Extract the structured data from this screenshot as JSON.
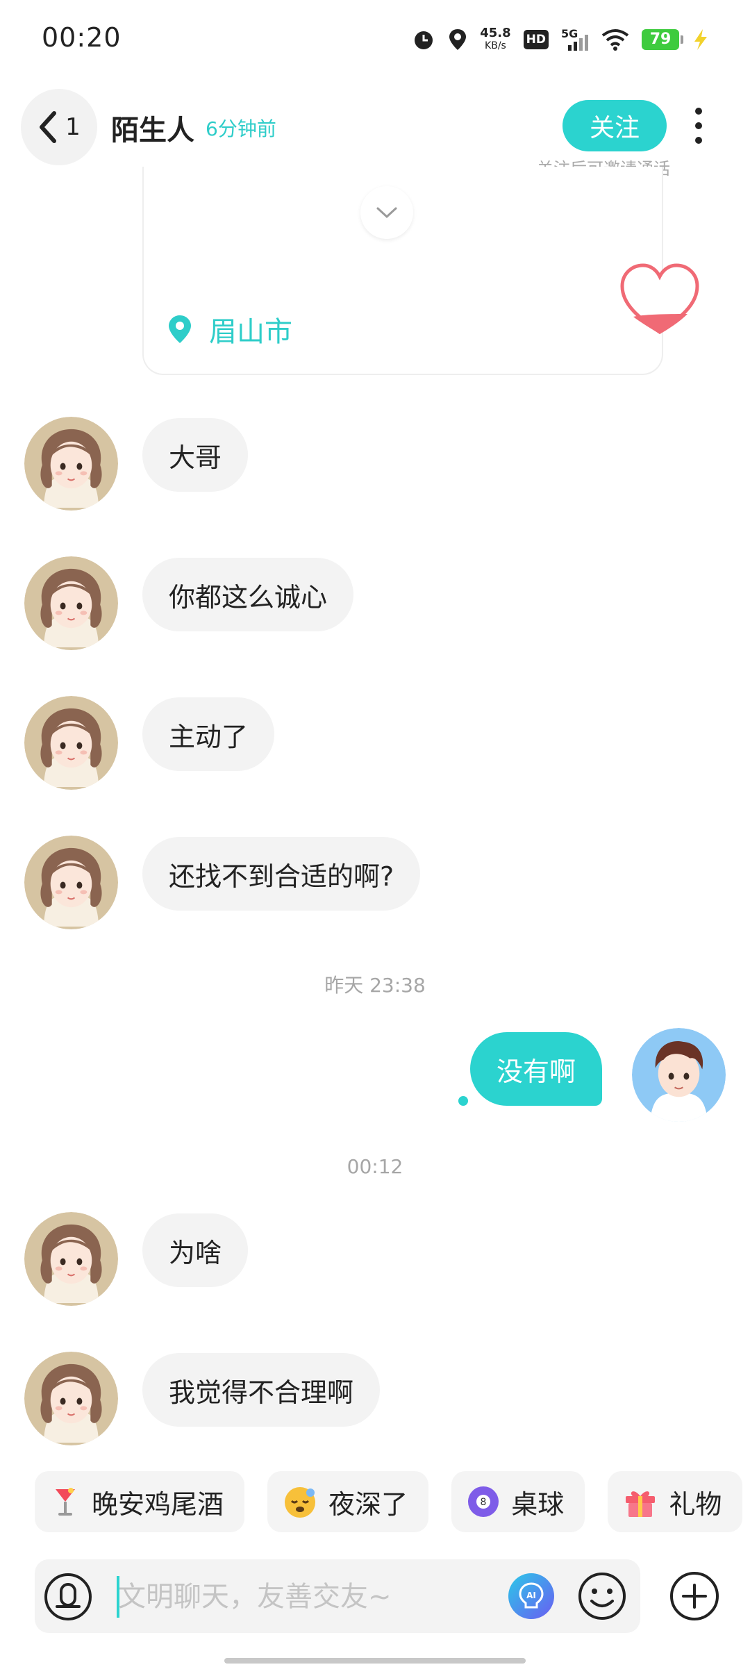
{
  "status_bar": {
    "time": "00:20",
    "net_speed_value": "45.8",
    "net_speed_unit": "KB/s",
    "hd_label": "HD",
    "network_label": "5G",
    "battery_level": "79",
    "icons": [
      "alarm-icon",
      "location-icon",
      "hd-icon",
      "signal-5g-icon",
      "wifi-icon",
      "battery-icon",
      "charging-icon"
    ]
  },
  "header": {
    "back_count": "1",
    "title": "陌生人",
    "last_seen": "6分钟前",
    "follow_label": "关注",
    "follow_hint": "关注后可邀请通话"
  },
  "profile_card": {
    "location": "眉山市"
  },
  "chat": {
    "group1": [
      "大哥",
      "你都这么诚心",
      "主动了",
      "还找不到合适的啊?"
    ],
    "timestamp1": "昨天 23:38",
    "sent": "没有啊",
    "timestamp2": "00:12",
    "group2": [
      "为啥",
      "我觉得不合理啊"
    ]
  },
  "quick_chips": [
    {
      "label": "晚安鸡尾酒",
      "icon": "cocktail-icon"
    },
    {
      "label": "夜深了",
      "icon": "sleepy-face-icon"
    },
    {
      "label": "桌球",
      "icon": "billiard-ball-icon"
    },
    {
      "label": "礼物",
      "icon": "gift-icon"
    }
  ],
  "input": {
    "placeholder": "文明聊天，友善交友~",
    "value": ""
  },
  "colors": {
    "accent": "#2bd3cf",
    "bubble_in": "#f3f3f3",
    "battery": "#3ecb3e"
  }
}
